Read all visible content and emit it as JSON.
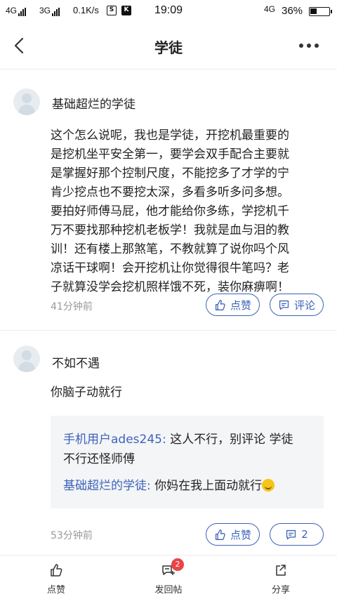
{
  "status_bar": {
    "sig1": "4G",
    "sig2": "3G",
    "speed": "0.1K/s",
    "icon_s": "S",
    "icon_k": "K",
    "time": "19:09",
    "right_sig": "4G",
    "battery_pct": "36%",
    "battery_level": 0.36
  },
  "nav": {
    "title": "学徒"
  },
  "posts": [
    {
      "author": "基础超烂的学徒",
      "lines": [
        "这个怎么说呢，我也是学徒，开挖机最重要的",
        "是挖机坐平安全第一，要学会双手配合主要就",
        "是掌握好那个控制尺度，不能挖多了才学的宁",
        "肯少挖点也不要挖太深，多看多听多问多想。",
        "要拍好师傅马屁，他才能给你多练，学挖机千",
        "万不要找那种挖机老板学！我就是血与泪的教",
        "训！还有楼上那煞笔，不教就算了说你吗个风",
        "凉话干球啊！会开挖机让你觉得很牛笔吗？老",
        "子就算没学会挖机照样饿不死，装你麻痹啊！"
      ],
      "time": "41分钟前",
      "like_label": "点赞",
      "comment_label": "评论"
    },
    {
      "author": "不如不遇",
      "text": "你脑子动就行",
      "replies": [
        {
          "name": "手机用户ades245:",
          "text1": " 这人不行，别评论 学徒",
          "text2": "不行还怪师傅"
        },
        {
          "name": "基础超烂的学徒:",
          "text1": " 你妈在我上面动就行"
        }
      ],
      "time": "53分钟前",
      "like_label": "点赞",
      "comment_count": "2"
    }
  ],
  "bottom_bar": {
    "like_label": "点赞",
    "reply_label": "发回帖",
    "reply_badge": "2",
    "share_label": "分享"
  },
  "colors": {
    "accent": "#3d63b8",
    "badge": "#e94545",
    "quote_bg": "#f4f5f7"
  }
}
